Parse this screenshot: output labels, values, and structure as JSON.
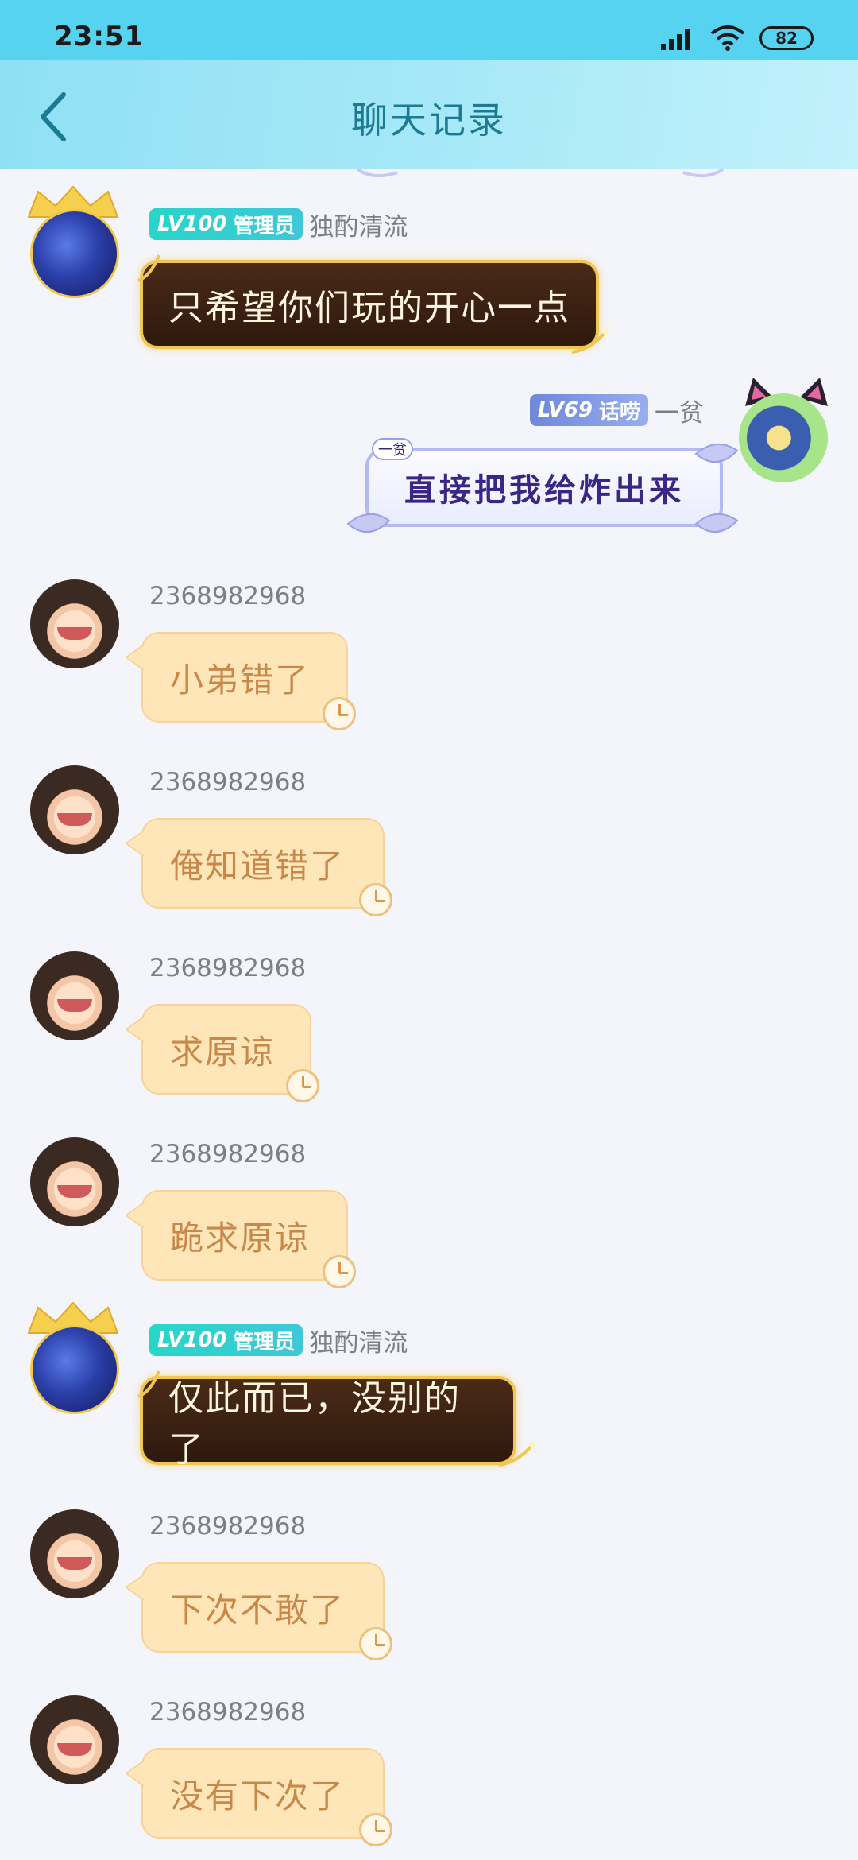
{
  "status_bar": {
    "time": "23:51",
    "battery": "82"
  },
  "header": {
    "title": "聊天记录"
  },
  "messages": [
    {
      "sender": "独酌清流",
      "level": "LV100",
      "role": "管理员",
      "text": "只希望你们玩的开心一点"
    },
    {
      "sender": "一贫",
      "level": "LV69",
      "role": "话唠",
      "tag": "一贫",
      "text": "直接把我给炸出来"
    },
    {
      "sender": "2368982968",
      "text": "小弟错了"
    },
    {
      "sender": "2368982968",
      "text": "俺知道错了"
    },
    {
      "sender": "2368982968",
      "text": "求原谅"
    },
    {
      "sender": "2368982968",
      "text": "跪求原谅"
    },
    {
      "sender": "独酌清流",
      "level": "LV100",
      "role": "管理员",
      "text": "仅此而已，没别的了"
    },
    {
      "sender": "2368982968",
      "text": "下次不敢了"
    },
    {
      "sender": "2368982968",
      "text": "没有下次了"
    }
  ]
}
